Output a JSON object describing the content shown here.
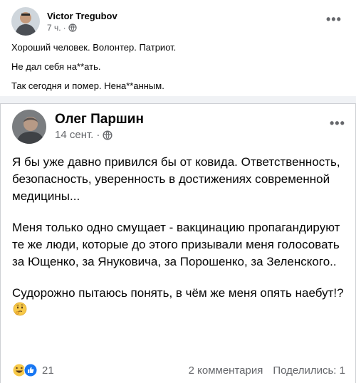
{
  "outer_post": {
    "author": "Victor Tregubov",
    "time": "7 ч.",
    "lines": [
      "Хороший человек. Волонтер. Патриот.",
      "Не дал себя на**ать.",
      "Так сегодня и помер. Нена**анным."
    ]
  },
  "shared_post": {
    "author": "Олег Паршин",
    "time": "14 сент.",
    "paragraphs": [
      "Я бы уже давно привился бы от ковида. Ответственность, безопасность, уверенность в достижениях современной медицины...",
      "Меня только одно смущает - вакцинацию пропагандируют те же люди, которые до этого призывали меня голосовать за Ющенко, за Януковича, за Порошенко, за Зеленского..",
      "Судорожно пытаюсь понять, в чём же меня опять наебут!?"
    ],
    "final_emoji": "thinking-face-icon"
  },
  "footer": {
    "reactions_count": "21",
    "reaction_icons": [
      "haha-icon",
      "like-icon"
    ],
    "comments": "2 комментария",
    "shares": "Поделились: 1"
  },
  "colors": {
    "background": "#f0f2f5",
    "text": "#050505",
    "secondary_text": "#65676b",
    "like_blue": "#1877f2",
    "emoji_yellow": "#f7c948"
  }
}
